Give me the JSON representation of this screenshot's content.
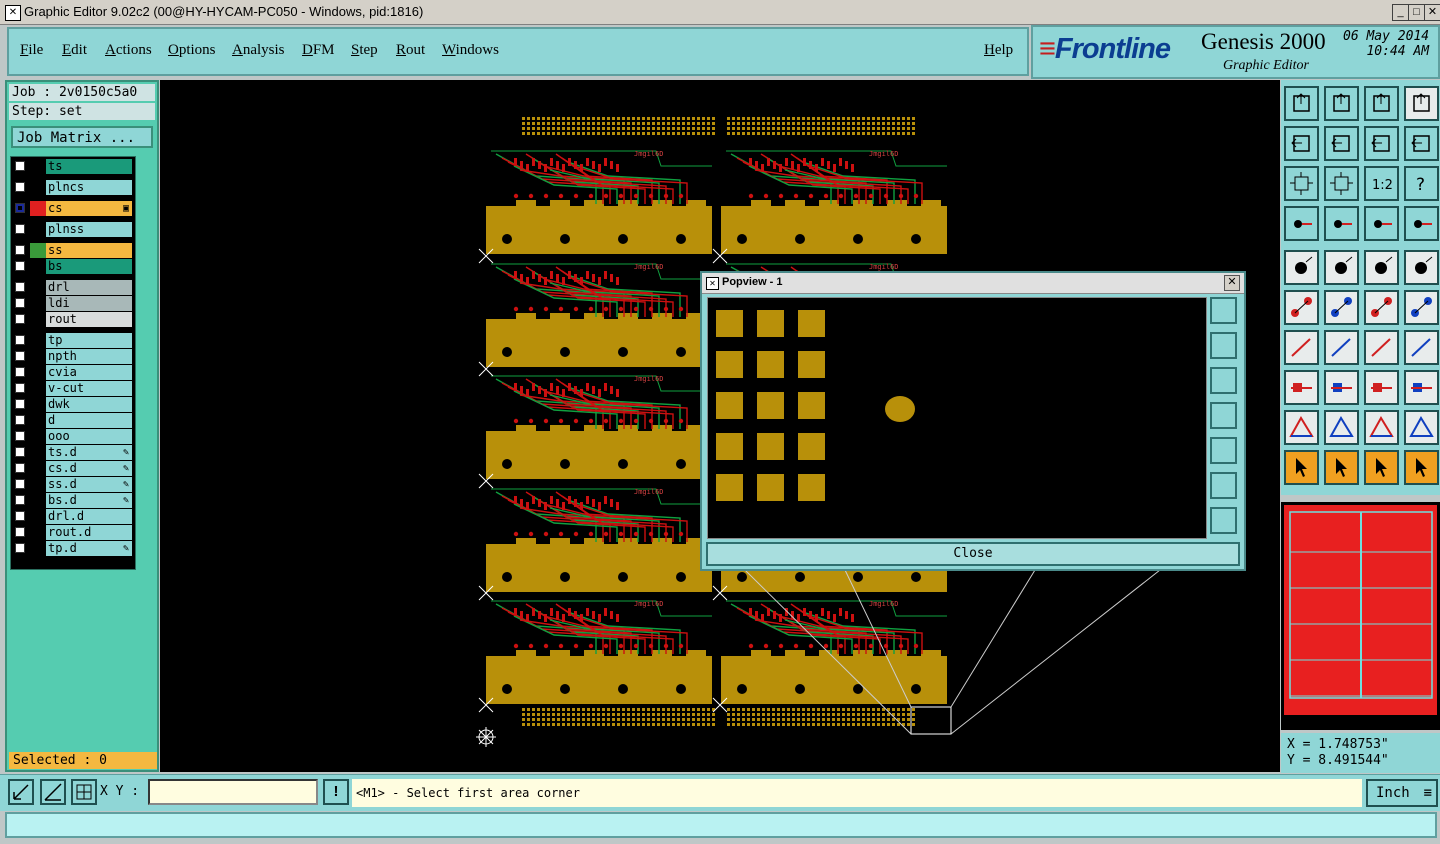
{
  "window": {
    "title": "Graphic Editor 9.02c2 (00@HY-HYCAM-PC050 - Windows, pid:1816)",
    "min": "_",
    "max": "□",
    "close": "✕"
  },
  "menu": {
    "items": [
      "File",
      "Edit",
      "Actions",
      "Options",
      "Analysis",
      "DFM",
      "Step",
      "Rout",
      "Windows"
    ],
    "help": "Help"
  },
  "brand": {
    "logo": "Frontline",
    "product": "Genesis 2000",
    "subtitle": "Graphic Editor",
    "date": "06 May 2014",
    "time": "10:44 AM"
  },
  "left": {
    "job": "Job : 2v0150c5a0",
    "step": "Step: set",
    "job_matrix": "Job Matrix ...",
    "selected": "Selected : 0",
    "layers": [
      {
        "name": "ts",
        "color": "#1a9a7a",
        "swatch": "#000",
        "checked": false,
        "mark": ""
      },
      {
        "name": "plncs",
        "color": "#8fd6d6",
        "swatch": "#000",
        "checked": false,
        "mark": ""
      },
      {
        "name": "cs",
        "color": "#f4b840",
        "swatch": "#e02020",
        "checked": true,
        "mark": "▣"
      },
      {
        "name": "plnss",
        "color": "#8fd6d6",
        "swatch": "#000",
        "checked": false,
        "mark": ""
      },
      {
        "name": "ss",
        "color": "#f4b840",
        "swatch": "#3a9a3a",
        "checked": false,
        "mark": ""
      },
      {
        "name": "bs",
        "color": "#1a9a7a",
        "swatch": "#000",
        "checked": false,
        "mark": ""
      },
      {
        "name": "drl",
        "color": "#a8b8b8",
        "swatch": "#000",
        "checked": false,
        "mark": ""
      },
      {
        "name": "ldi",
        "color": "#a8b8b8",
        "swatch": "#000",
        "checked": false,
        "mark": ""
      },
      {
        "name": "rout",
        "color": "#d8dcdc",
        "swatch": "#000",
        "checked": false,
        "mark": ""
      },
      {
        "name": "tp",
        "color": "#8fd6d6",
        "swatch": "#000",
        "checked": false,
        "mark": ""
      },
      {
        "name": "npth",
        "color": "#8fd6d6",
        "swatch": "#000",
        "checked": false,
        "mark": ""
      },
      {
        "name": "cvia",
        "color": "#8fd6d6",
        "swatch": "#000",
        "checked": false,
        "mark": ""
      },
      {
        "name": "v-cut",
        "color": "#8fd6d6",
        "swatch": "#000",
        "checked": false,
        "mark": ""
      },
      {
        "name": "dwk",
        "color": "#8fd6d6",
        "swatch": "#000",
        "checked": false,
        "mark": ""
      },
      {
        "name": "d",
        "color": "#8fd6d6",
        "swatch": "#000",
        "checked": false,
        "mark": ""
      },
      {
        "name": "ooo",
        "color": "#8fd6d6",
        "swatch": "#000",
        "checked": false,
        "mark": ""
      },
      {
        "name": "ts.d",
        "color": "#8fd6d6",
        "swatch": "#000",
        "checked": false,
        "mark": "✎"
      },
      {
        "name": "cs.d",
        "color": "#8fd6d6",
        "swatch": "#000",
        "checked": false,
        "mark": "✎"
      },
      {
        "name": "ss.d",
        "color": "#8fd6d6",
        "swatch": "#000",
        "checked": false,
        "mark": "✎"
      },
      {
        "name": "bs.d",
        "color": "#8fd6d6",
        "swatch": "#000",
        "checked": false,
        "mark": "✎"
      },
      {
        "name": "drl.d",
        "color": "#8fd6d6",
        "swatch": "#000",
        "checked": false,
        "mark": ""
      },
      {
        "name": "rout.d",
        "color": "#8fd6d6",
        "swatch": "#000",
        "checked": false,
        "mark": ""
      },
      {
        "name": "tp.d",
        "color": "#8fd6d6",
        "swatch": "#000",
        "checked": false,
        "mark": "✎"
      }
    ]
  },
  "popview": {
    "title": "Popview - 1",
    "close_label": "Close"
  },
  "pcb": {
    "label": "Jmgil6D",
    "board_color": "#b8900a",
    "trace_red": "#cc1010",
    "trace_green": "#10a040"
  },
  "coords": {
    "x": "X = 1.748753\"",
    "y": "Y = 8.491544\""
  },
  "bottom": {
    "xy_label": "X Y :",
    "prompt": "<M1> - Select first area corner",
    "unit": "Inch",
    "info_icon": "!"
  }
}
